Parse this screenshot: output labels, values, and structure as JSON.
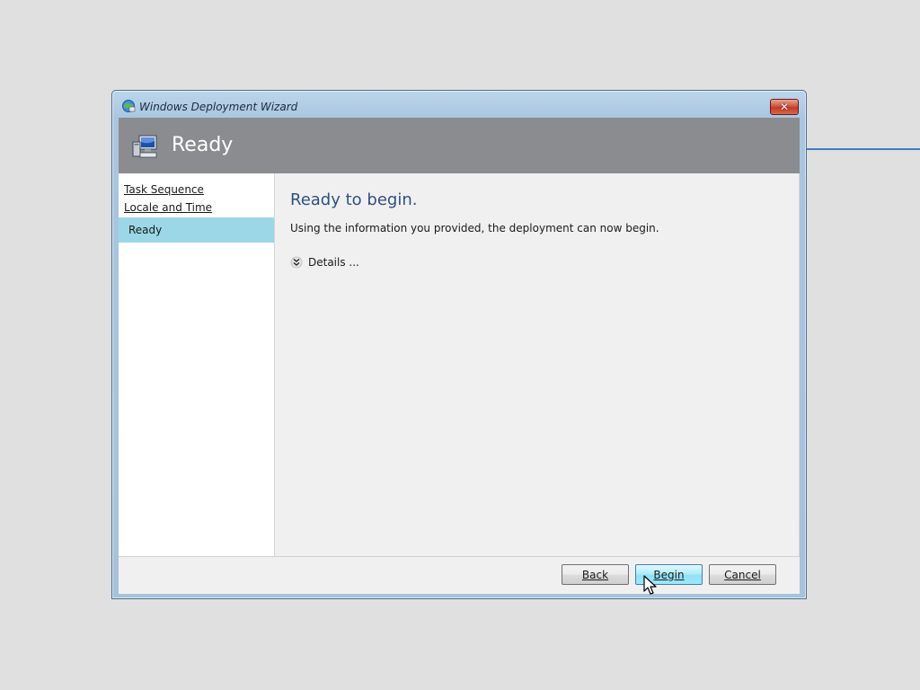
{
  "window": {
    "title": "Windows Deployment Wizard",
    "close_label": "✕"
  },
  "header": {
    "title": "Ready"
  },
  "nav": {
    "items": [
      {
        "label": "Task Sequence",
        "state": "completed"
      },
      {
        "label": "Locale and Time",
        "state": "completed"
      },
      {
        "label": "Ready",
        "state": "active"
      }
    ]
  },
  "main": {
    "title": "Ready to begin.",
    "description": "Using the information you provided, the deployment can now begin.",
    "details_label": "Details ..."
  },
  "footer": {
    "back_label": "Back",
    "begin_label": "Begin",
    "cancel_label": "Cancel"
  },
  "colors": {
    "header_bg": "#8a8c8f",
    "active_nav_bg": "#9bd7e6",
    "title_blue": "#2e4f86",
    "primary_button": "#aeeefb"
  }
}
